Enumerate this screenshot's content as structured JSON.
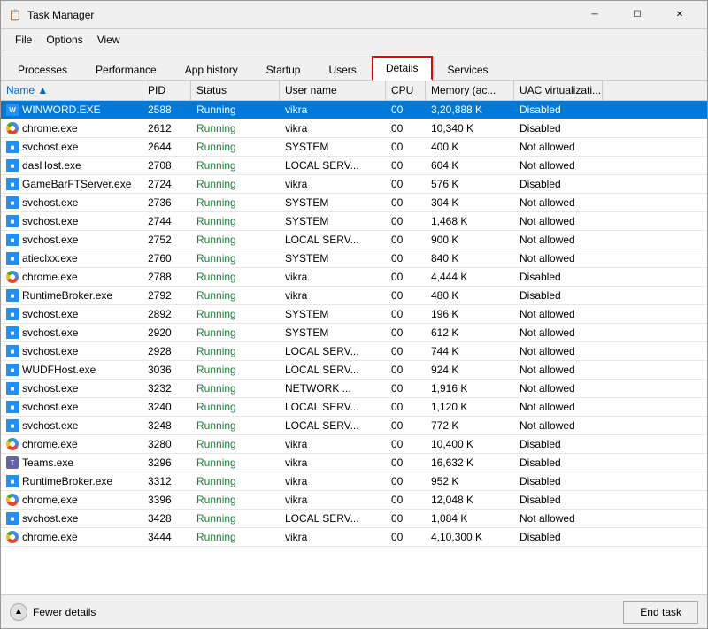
{
  "window": {
    "title": "Task Manager",
    "icon": "📋"
  },
  "menu": {
    "items": [
      "File",
      "Options",
      "View"
    ]
  },
  "tabs": [
    {
      "label": "Processes",
      "active": false
    },
    {
      "label": "Performance",
      "active": false
    },
    {
      "label": "App history",
      "active": false
    },
    {
      "label": "Startup",
      "active": false
    },
    {
      "label": "Users",
      "active": false
    },
    {
      "label": "Details",
      "active": true,
      "highlighted": true
    },
    {
      "label": "Services",
      "active": false
    }
  ],
  "columns": [
    {
      "label": "Name",
      "sorted": true
    },
    {
      "label": "PID"
    },
    {
      "label": "Status"
    },
    {
      "label": "User name"
    },
    {
      "label": "CPU"
    },
    {
      "label": "Memory (ac..."
    },
    {
      "label": "UAC virtualizati..."
    }
  ],
  "rows": [
    {
      "name": "WINWORD.EXE",
      "pid": "2588",
      "status": "Running",
      "user": "vikra",
      "cpu": "00",
      "memory": "3,20,888 K",
      "uac": "Disabled",
      "icon": "word",
      "selected": true
    },
    {
      "name": "chrome.exe",
      "pid": "2612",
      "status": "Running",
      "user": "vikra",
      "cpu": "00",
      "memory": "10,340 K",
      "uac": "Disabled",
      "icon": "chrome"
    },
    {
      "name": "svchost.exe",
      "pid": "2644",
      "status": "Running",
      "user": "SYSTEM",
      "cpu": "00",
      "memory": "400 K",
      "uac": "Not allowed",
      "icon": "blue"
    },
    {
      "name": "dasHost.exe",
      "pid": "2708",
      "status": "Running",
      "user": "LOCAL SERV...",
      "cpu": "00",
      "memory": "604 K",
      "uac": "Not allowed",
      "icon": "blue"
    },
    {
      "name": "GameBarFTServer.exe",
      "pid": "2724",
      "status": "Running",
      "user": "vikra",
      "cpu": "00",
      "memory": "576 K",
      "uac": "Disabled",
      "icon": "blue"
    },
    {
      "name": "svchost.exe",
      "pid": "2736",
      "status": "Running",
      "user": "SYSTEM",
      "cpu": "00",
      "memory": "304 K",
      "uac": "Not allowed",
      "icon": "blue"
    },
    {
      "name": "svchost.exe",
      "pid": "2744",
      "status": "Running",
      "user": "SYSTEM",
      "cpu": "00",
      "memory": "1,468 K",
      "uac": "Not allowed",
      "icon": "blue"
    },
    {
      "name": "svchost.exe",
      "pid": "2752",
      "status": "Running",
      "user": "LOCAL SERV...",
      "cpu": "00",
      "memory": "900 K",
      "uac": "Not allowed",
      "icon": "blue"
    },
    {
      "name": "atieclxx.exe",
      "pid": "2760",
      "status": "Running",
      "user": "SYSTEM",
      "cpu": "00",
      "memory": "840 K",
      "uac": "Not allowed",
      "icon": "blue"
    },
    {
      "name": "chrome.exe",
      "pid": "2788",
      "status": "Running",
      "user": "vikra",
      "cpu": "00",
      "memory": "4,444 K",
      "uac": "Disabled",
      "icon": "chrome"
    },
    {
      "name": "RuntimeBroker.exe",
      "pid": "2792",
      "status": "Running",
      "user": "vikra",
      "cpu": "00",
      "memory": "480 K",
      "uac": "Disabled",
      "icon": "blue"
    },
    {
      "name": "svchost.exe",
      "pid": "2892",
      "status": "Running",
      "user": "SYSTEM",
      "cpu": "00",
      "memory": "196 K",
      "uac": "Not allowed",
      "icon": "blue"
    },
    {
      "name": "svchost.exe",
      "pid": "2920",
      "status": "Running",
      "user": "SYSTEM",
      "cpu": "00",
      "memory": "612 K",
      "uac": "Not allowed",
      "icon": "blue"
    },
    {
      "name": "svchost.exe",
      "pid": "2928",
      "status": "Running",
      "user": "LOCAL SERV...",
      "cpu": "00",
      "memory": "744 K",
      "uac": "Not allowed",
      "icon": "blue"
    },
    {
      "name": "WUDFHost.exe",
      "pid": "3036",
      "status": "Running",
      "user": "LOCAL SERV...",
      "cpu": "00",
      "memory": "924 K",
      "uac": "Not allowed",
      "icon": "blue"
    },
    {
      "name": "svchost.exe",
      "pid": "3232",
      "status": "Running",
      "user": "NETWORK ...",
      "cpu": "00",
      "memory": "1,916 K",
      "uac": "Not allowed",
      "icon": "blue"
    },
    {
      "name": "svchost.exe",
      "pid": "3240",
      "status": "Running",
      "user": "LOCAL SERV...",
      "cpu": "00",
      "memory": "1,120 K",
      "uac": "Not allowed",
      "icon": "blue"
    },
    {
      "name": "svchost.exe",
      "pid": "3248",
      "status": "Running",
      "user": "LOCAL SERV...",
      "cpu": "00",
      "memory": "772 K",
      "uac": "Not allowed",
      "icon": "blue"
    },
    {
      "name": "chrome.exe",
      "pid": "3280",
      "status": "Running",
      "user": "vikra",
      "cpu": "00",
      "memory": "10,400 K",
      "uac": "Disabled",
      "icon": "chrome"
    },
    {
      "name": "Teams.exe",
      "pid": "3296",
      "status": "Running",
      "user": "vikra",
      "cpu": "00",
      "memory": "16,632 K",
      "uac": "Disabled",
      "icon": "teams"
    },
    {
      "name": "RuntimeBroker.exe",
      "pid": "3312",
      "status": "Running",
      "user": "vikra",
      "cpu": "00",
      "memory": "952 K",
      "uac": "Disabled",
      "icon": "blue"
    },
    {
      "name": "chrome.exe",
      "pid": "3396",
      "status": "Running",
      "user": "vikra",
      "cpu": "00",
      "memory": "12,048 K",
      "uac": "Disabled",
      "icon": "chrome"
    },
    {
      "name": "svchost.exe",
      "pid": "3428",
      "status": "Running",
      "user": "LOCAL SERV...",
      "cpu": "00",
      "memory": "1,084 K",
      "uac": "Not allowed",
      "icon": "blue"
    },
    {
      "name": "chrome.exe",
      "pid": "3444",
      "status": "Running",
      "user": "vikra",
      "cpu": "00",
      "memory": "4,10,300 K",
      "uac": "Disabled",
      "icon": "chrome"
    }
  ],
  "footer": {
    "fewer_details": "Fewer details",
    "end_task": "End task"
  }
}
